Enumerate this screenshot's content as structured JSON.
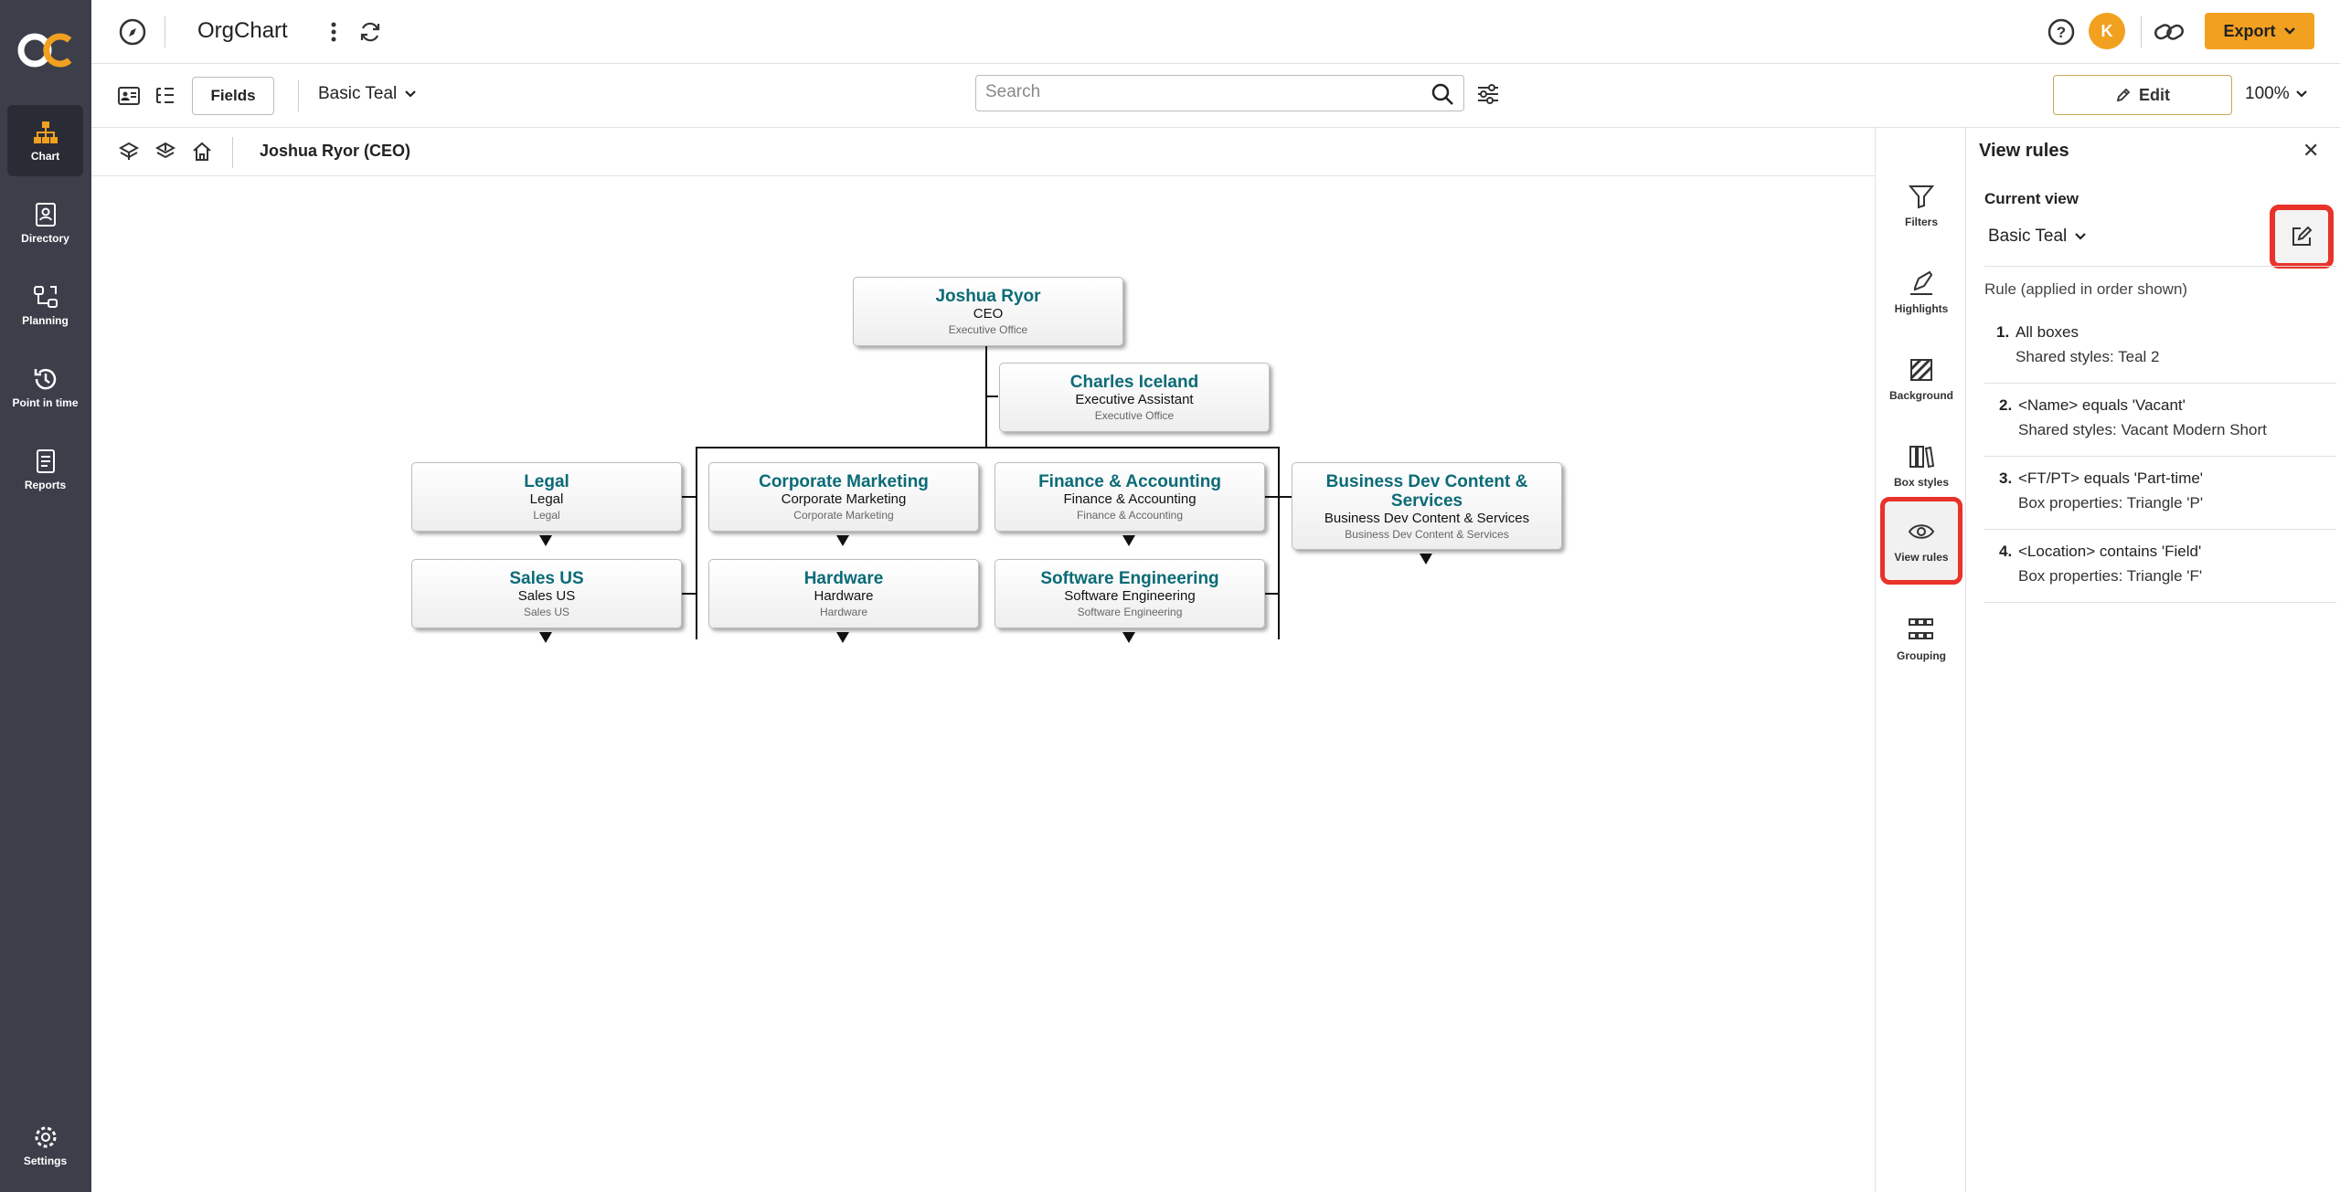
{
  "app": {
    "title": "OrgChart",
    "logo_text": "OC",
    "user_initial": "K",
    "export_label": "Export"
  },
  "rail": {
    "items": [
      {
        "label": "Chart",
        "icon": "org-chart-icon"
      },
      {
        "label": "Directory",
        "icon": "directory-icon"
      },
      {
        "label": "Planning",
        "icon": "planning-icon"
      },
      {
        "label": "Point in time",
        "icon": "history-icon"
      },
      {
        "label": "Reports",
        "icon": "reports-icon"
      }
    ],
    "settings_label": "Settings"
  },
  "toolbar": {
    "fields_label": "Fields",
    "theme": "Basic Teal",
    "search_placeholder": "Search",
    "edit_label": "Edit",
    "zoom": "100%"
  },
  "breadcrumb": "Joshua Ryor (CEO)",
  "nodes": [
    {
      "name": "Joshua Ryor",
      "title": "CEO",
      "dept": "Executive Office"
    },
    {
      "name": "Charles Iceland",
      "title": "Executive Assistant",
      "dept": "Executive Office"
    },
    {
      "name": "Legal",
      "title": "Legal",
      "dept": "Legal"
    },
    {
      "name": "Corporate Marketing",
      "title": "Corporate Marketing",
      "dept": "Corporate Marketing"
    },
    {
      "name": "Finance & Accounting",
      "title": "Finance & Accounting",
      "dept": "Finance & Accounting"
    },
    {
      "name": "Business Dev Content & Services",
      "title": "Business Dev Content & Services",
      "dept": "Business Dev Content & Services"
    },
    {
      "name": "Sales US",
      "title": "Sales US",
      "dept": "Sales US"
    },
    {
      "name": "Hardware",
      "title": "Hardware",
      "dept": "Hardware"
    },
    {
      "name": "Software Engineering",
      "title": "Software Engineering",
      "dept": "Software Engineering"
    }
  ],
  "tools": [
    {
      "label": "Filters",
      "icon": "filter-icon"
    },
    {
      "label": "Highlights",
      "icon": "highlighter-icon"
    },
    {
      "label": "Background",
      "icon": "background-icon"
    },
    {
      "label": "Box styles",
      "icon": "box-styles-icon"
    },
    {
      "label": "View rules",
      "icon": "eye-icon"
    },
    {
      "label": "Grouping",
      "icon": "grouping-icon"
    }
  ],
  "panel": {
    "title": "View rules",
    "current_view_label": "Current view",
    "current_view": "Basic Teal",
    "rules_heading": "Rule (applied in order shown)",
    "rules": [
      {
        "num": "1.",
        "condition": "All boxes",
        "effect": "Shared styles: Teal 2"
      },
      {
        "num": "2.",
        "condition": "<Name> equals 'Vacant'",
        "effect": "Shared styles: Vacant Modern Short"
      },
      {
        "num": "3.",
        "condition": "<FT/PT> equals 'Part-time'",
        "effect": "Box properties: Triangle 'P'"
      },
      {
        "num": "4.",
        "condition": "<Location> contains 'Field'",
        "effect": "Box properties: Triangle 'F'"
      }
    ]
  }
}
